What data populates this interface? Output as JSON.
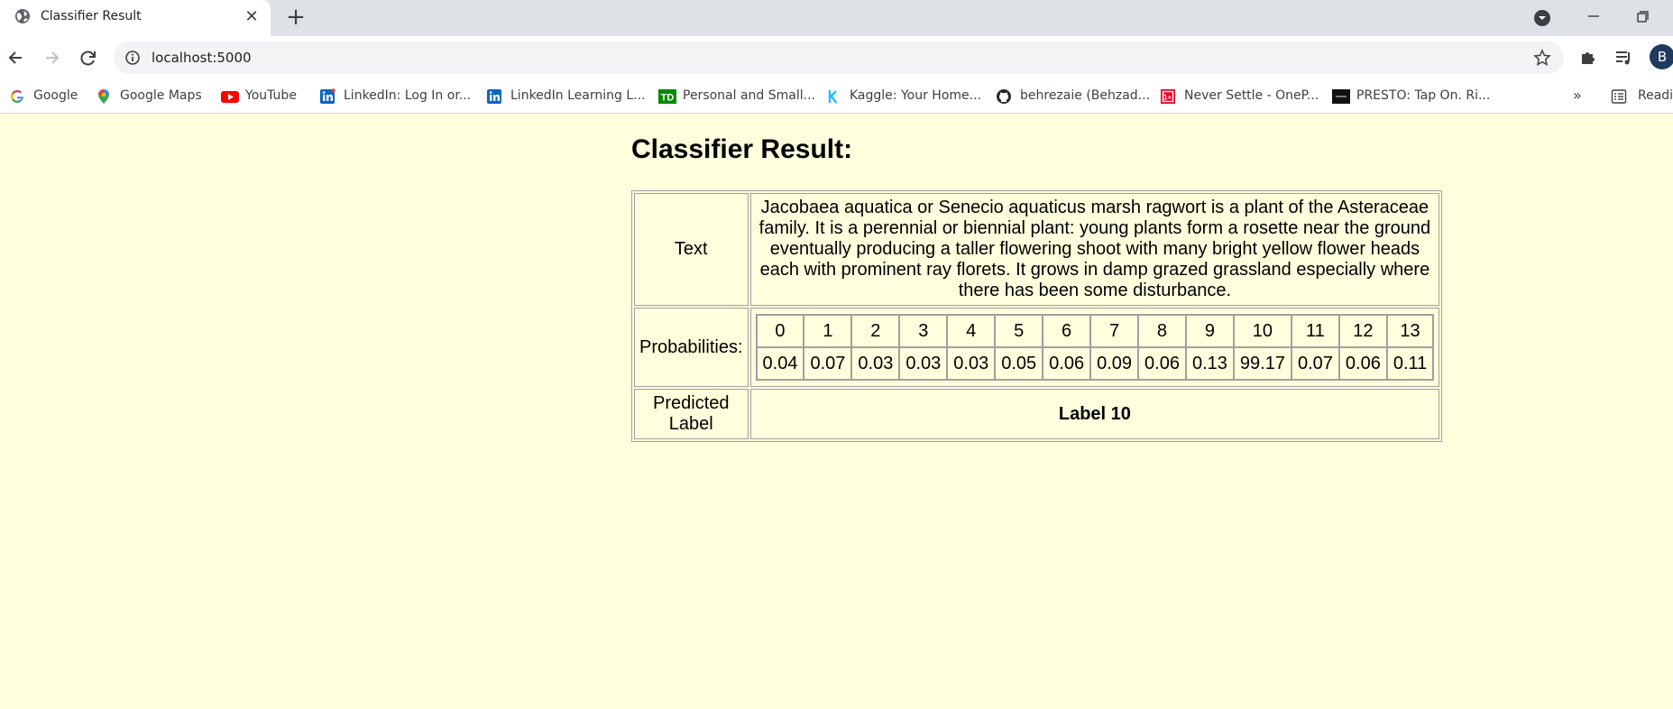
{
  "browser": {
    "tab": {
      "title": "Classifier Result",
      "close_glyph": "✕",
      "favicon": "globe-icon"
    },
    "new_tab_glyph": "+",
    "address_bar": {
      "url": "localhost:5000"
    },
    "profile_initial": "B",
    "bookmarks": [
      {
        "label": "Google",
        "icon": "google-icon"
      },
      {
        "label": "Google Maps",
        "icon": "maps-pin-icon"
      },
      {
        "label": "YouTube",
        "icon": "youtube-icon"
      },
      {
        "label": "LinkedIn: Log In or...",
        "icon": "linkedin-icon"
      },
      {
        "label": "LinkedIn Learning L...",
        "icon": "linkedin-icon"
      },
      {
        "label": "Personal and Small...",
        "icon": "td-bank-icon"
      },
      {
        "label": "Kaggle: Your Home...",
        "icon": "kaggle-icon"
      },
      {
        "label": "behrezaie (Behzad...",
        "icon": "github-icon"
      },
      {
        "label": "Never Settle - OneP...",
        "icon": "oneplus-icon"
      },
      {
        "label": "PRESTO: Tap On. Ri...",
        "icon": "presto-icon"
      }
    ],
    "bookmarks_overflow": "»",
    "reading_list_label": "Readin"
  },
  "page": {
    "title": "Classifier Result:",
    "rows": {
      "text_label": "Text",
      "text_value": "Jacobaea aquatica or Senecio aquaticus marsh ragwort is a plant of the Asteraceae family. It is a perennial or biennial plant: young plants form a rosette near the ground eventually producing a taller flowering shoot with many bright yellow flower heads each with prominent ray florets. It grows in damp grazed grassland especially where there has been some disturbance.",
      "probabilities_label": "Probabilities:",
      "predicted_label": "Predicted Label",
      "predicted_value": "Label 10"
    },
    "probabilities": {
      "labels": [
        "0",
        "1",
        "2",
        "3",
        "4",
        "5",
        "6",
        "7",
        "8",
        "9",
        "10",
        "11",
        "12",
        "13"
      ],
      "values": [
        "0.04",
        "0.07",
        "0.03",
        "0.03",
        "0.03",
        "0.05",
        "0.06",
        "0.09",
        "0.06",
        "0.13",
        "99.17",
        "0.07",
        "0.06",
        "0.11"
      ]
    }
  },
  "colors": {
    "page_background": "#ffffdd",
    "tabstrip_background": "#dee1e6",
    "table_border": "#a0a0a0"
  }
}
